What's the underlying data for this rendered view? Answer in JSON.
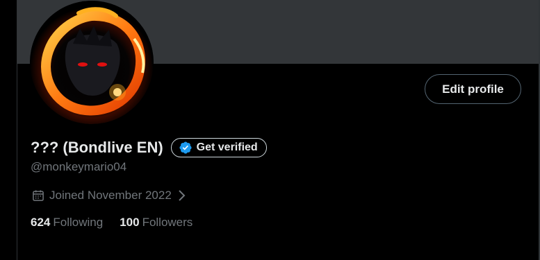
{
  "profile": {
    "display_name": "??? (Bondlive EN)",
    "handle": "@monkeymario04",
    "joined": "Joined November 2022",
    "following_count": "624",
    "following_label": "Following",
    "followers_count": "100",
    "followers_label": "Followers"
  },
  "buttons": {
    "edit_profile": "Edit profile",
    "get_verified": "Get verified"
  },
  "colors": {
    "background": "#000000",
    "banner": "#333639",
    "muted_text": "#71767b",
    "verified_blue": "#1d9bf0"
  },
  "icons": {
    "verified": "verified-badge-icon",
    "calendar": "calendar-icon",
    "chevron": "chevron-right-icon"
  }
}
